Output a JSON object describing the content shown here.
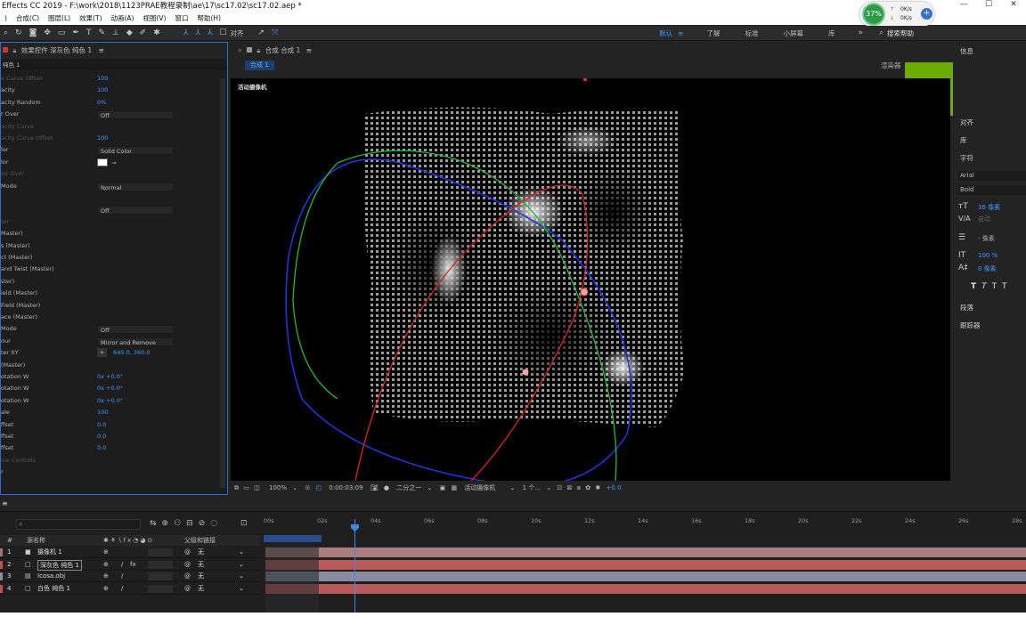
{
  "title_bar": {
    "text": "Effects CC 2019 - F:\\work\\2018\\1123PRAE教程录制\\ae\\17\\sc17.02\\sc17.02.aep *"
  },
  "menu": [
    ")",
    "合成(C)",
    "图层(L)",
    "效果(T)",
    "动画(A)",
    "视图(V)",
    "窗口",
    "帮助(H)"
  ],
  "net_widget": {
    "percent": "37%",
    "up": "0K/s",
    "down": "0K/s"
  },
  "workspaces": [
    "默认",
    "了解",
    "标准",
    "小屏幕",
    "库"
  ],
  "search_help": "搜索帮助",
  "snap_label": "对齐",
  "left_panel": {
    "tab": "效果控件 深灰色 纯色 1",
    "layer_name": "纯色 1",
    "rows": [
      {
        "label": "e Curve Offset",
        "value": "100",
        "dim": true
      },
      {
        "label": "acity",
        "value": "100"
      },
      {
        "label": "acity Random",
        "value": "0%"
      },
      {
        "label": "r Over",
        "dropdown": "Off"
      },
      {
        "label": "acity Curve",
        "value": "",
        "dim": true
      },
      {
        "label": "acity Curve Offset",
        "value": "100",
        "dim": true
      },
      {
        "label": "lor",
        "dropdown": "Solid Color"
      },
      {
        "label": "lor",
        "value": "",
        "swatch": true
      },
      {
        "label": "lor Over",
        "value": "",
        "dim": true
      },
      {
        "label": "Mode",
        "dropdown": "Normal"
      },
      {
        "label": "",
        "value": ""
      },
      {
        "label": "",
        "dropdown": "Off"
      },
      {
        "label": "ter",
        "value": "",
        "dim": true
      },
      {
        "label": "Master)",
        "value": ""
      },
      {
        "label": "s (Master)",
        "value": ""
      },
      {
        "label": "ct (Master)",
        "value": ""
      },
      {
        "label": "and Twist (Master)",
        "value": ""
      },
      {
        "label": "ster)",
        "value": ""
      },
      {
        "label": "ield (Master)",
        "value": ""
      },
      {
        "label": "Field (Master)",
        "value": ""
      },
      {
        "label": "ace (Master)",
        "value": ""
      },
      {
        "label": "Mode",
        "dropdown": "Off"
      },
      {
        "label": "our",
        "dropdown": "Mirror and Remove"
      },
      {
        "label": "ter XY",
        "value": "640.0, 360.0"
      },
      {
        "label": "(Master)",
        "value": ""
      },
      {
        "label": "otation W",
        "value": "0x +0.0°"
      },
      {
        "label": "otation W",
        "value": "0x +0.0°"
      },
      {
        "label": "otation W",
        "value": "0x +0.0°"
      },
      {
        "label": "ale",
        "value": "100"
      },
      {
        "label": "ffset",
        "value": "0.0"
      },
      {
        "label": "ffset",
        "value": "0.0"
      },
      {
        "label": "ffset",
        "value": "0.0"
      },
      {
        "label": "ine Controls",
        "value": "",
        "dim": true
      },
      {
        "label": "r",
        "value": ""
      }
    ]
  },
  "comp": {
    "tab": "合成 合成 1",
    "sub_tab": "合成 1",
    "renderer": "渲染器",
    "camera_label": "活动摄像机",
    "zoom": "100%",
    "timecode": "0:00:03:09",
    "resolution": "二分之一",
    "view": "活动摄像机",
    "views_count": "1 个...",
    "exposure": "+0.0"
  },
  "right_panel": {
    "items": [
      "信息",
      "对齐",
      "库",
      "字符"
    ],
    "font": "Arial",
    "style": "Bold",
    "size": "36 像素",
    "leading": "自动",
    "tracking": "- 像素",
    "scale": "100 %",
    "baseline": "0 像素",
    "sections": [
      "段落",
      "跟踪器"
    ]
  },
  "timeline": {
    "col_layer": "源名称",
    "col_parent": "父级和链接",
    "ticks": [
      "00s",
      "02s",
      "04s",
      "06s",
      "08s",
      "10s",
      "12s",
      "14s",
      "16s",
      "18s",
      "20s",
      "22s",
      "24s",
      "26s",
      "28s"
    ],
    "layers": [
      {
        "num": "1",
        "name": "摄像机 1",
        "parent": "无",
        "color": "#a37474",
        "bar": "#a87e7e"
      },
      {
        "num": "2",
        "name": "深灰色 纯色 1",
        "parent": "无",
        "color": "#c44d4d",
        "bar": "#b85a5a"
      },
      {
        "num": "3",
        "name": "Icosa.obj",
        "parent": "无",
        "color": "#8c8ca0",
        "bar": "#8a8aa0"
      },
      {
        "num": "4",
        "name": "白色 纯色 1",
        "parent": "无",
        "color": "#c44d4d",
        "bar": "#b85a5a"
      }
    ]
  }
}
